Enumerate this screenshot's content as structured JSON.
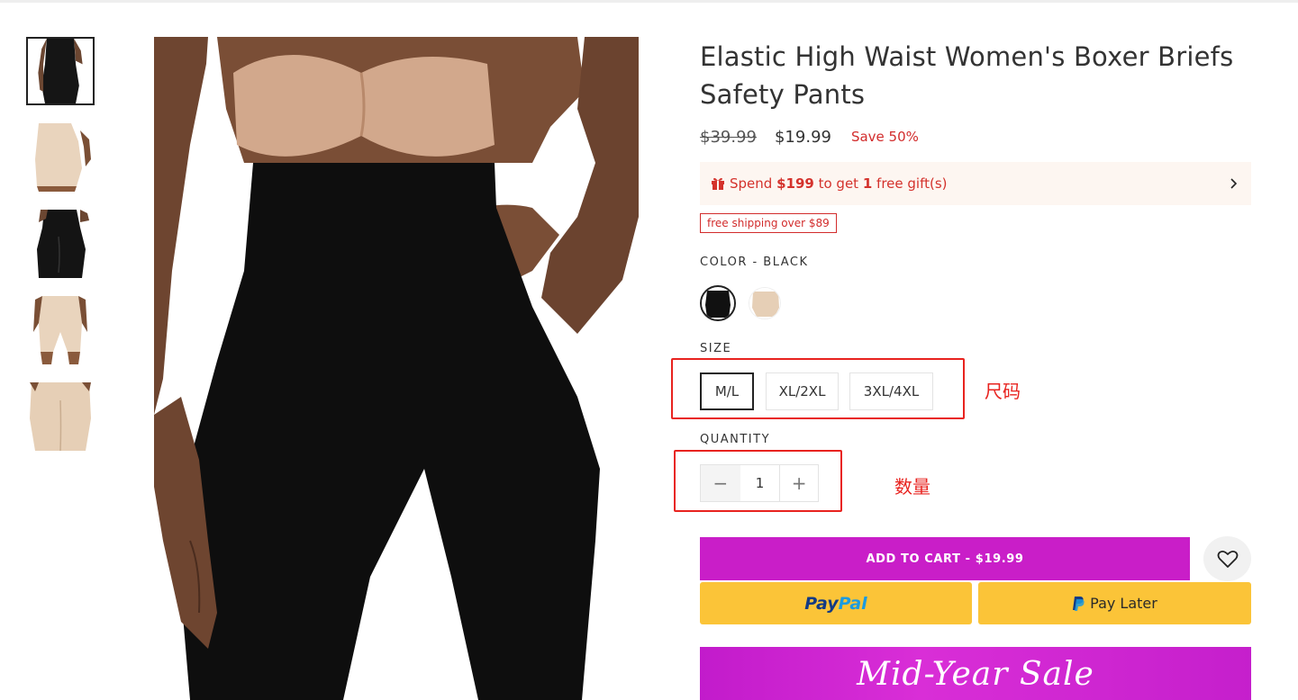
{
  "product": {
    "title": "Elastic High Waist Women's Boxer Briefs Safety Pants",
    "price_original": "$39.99",
    "price_current": "$19.99",
    "save_label": "Save 50%"
  },
  "gift_promo": {
    "text_before": "Spend ",
    "amount": "$199",
    "text_middle": " to get ",
    "count": "1",
    "text_after": " free gift(s)"
  },
  "shipping_badge": "free shipping over $89",
  "color": {
    "label": "COLOR - BLACK",
    "options": [
      "black",
      "beige"
    ],
    "selected": "black"
  },
  "size": {
    "label": "SIZE",
    "options": [
      "M/L",
      "XL/2XL",
      "3XL/4XL"
    ],
    "selected": "M/L"
  },
  "quantity": {
    "label": "QUANTITY",
    "value": "1",
    "minus": "−",
    "plus": "+"
  },
  "annotations": {
    "size_note": "尺码",
    "quantity_note": "数量"
  },
  "actions": {
    "add_to_cart": "ADD TO CART - $19.99",
    "paypal_part1": "Pay",
    "paypal_part2": "Pal",
    "pay_later": "Pay Later"
  },
  "promo_banner": "Mid-Year Sale",
  "thumbnails": [
    "black-front",
    "beige-side",
    "black-back",
    "beige-front",
    "beige-back"
  ],
  "colors": {
    "accent_purple": "#c91ec8",
    "sale_red": "#d22c2c",
    "annotation_red": "#e8231f",
    "paypal_yellow": "#fbc438"
  }
}
